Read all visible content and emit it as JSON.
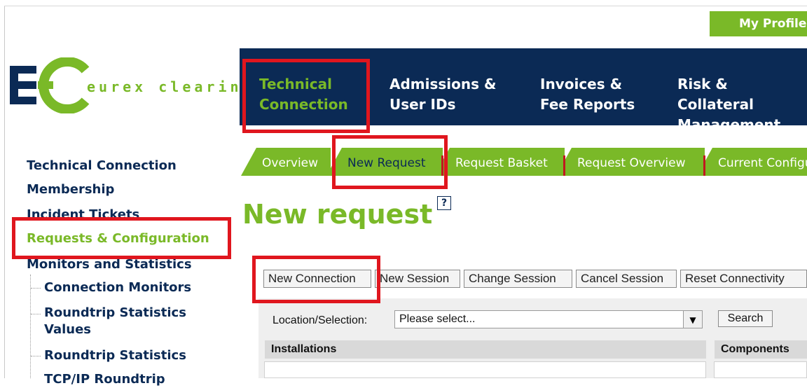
{
  "header": {
    "profile_label": "My Profile"
  },
  "logo": {
    "text": "eurex clearing",
    "brand_color": "#7ab928",
    "dark_color": "#0b2a55"
  },
  "topnav": {
    "items": [
      {
        "label": "Technical\nConnection",
        "active": true
      },
      {
        "label": "Admissions &\nUser IDs",
        "active": false
      },
      {
        "label": "Invoices &\nFee Reports",
        "active": false
      },
      {
        "label": "Risk & Collateral\nManagement",
        "active": false
      }
    ]
  },
  "leftnav": {
    "items": [
      {
        "label": "Technical Connection"
      },
      {
        "label": "Membership"
      },
      {
        "label": "Incident Tickets"
      },
      {
        "label": "Requests & Configuration",
        "active": true
      },
      {
        "label": "Monitors and Statistics"
      }
    ],
    "subitems": [
      {
        "label": "Connection Monitors"
      },
      {
        "label": "Roundtrip Statistics\nValues"
      },
      {
        "label": "Roundtrip Statistics"
      },
      {
        "label": "TCP/IP Roundtrip"
      }
    ]
  },
  "subtabs": [
    {
      "label": "Overview"
    },
    {
      "label": "New Request",
      "active": true
    },
    {
      "label": "Request Basket"
    },
    {
      "label": "Request Overview"
    },
    {
      "label": "Current Configuration"
    }
  ],
  "page": {
    "title": "New request",
    "help_icon": "?"
  },
  "actions": [
    {
      "label": "New Connection"
    },
    {
      "label": "New Session"
    },
    {
      "label": "Change Session"
    },
    {
      "label": "Cancel Session"
    },
    {
      "label": "Reset Connectivity"
    }
  ],
  "form": {
    "location_label": "Location/Selection:",
    "location_value": "Please select...",
    "search_label": "Search",
    "installations_header": "Installations",
    "components_header": "Components"
  },
  "highlight_color": "#e0161e"
}
